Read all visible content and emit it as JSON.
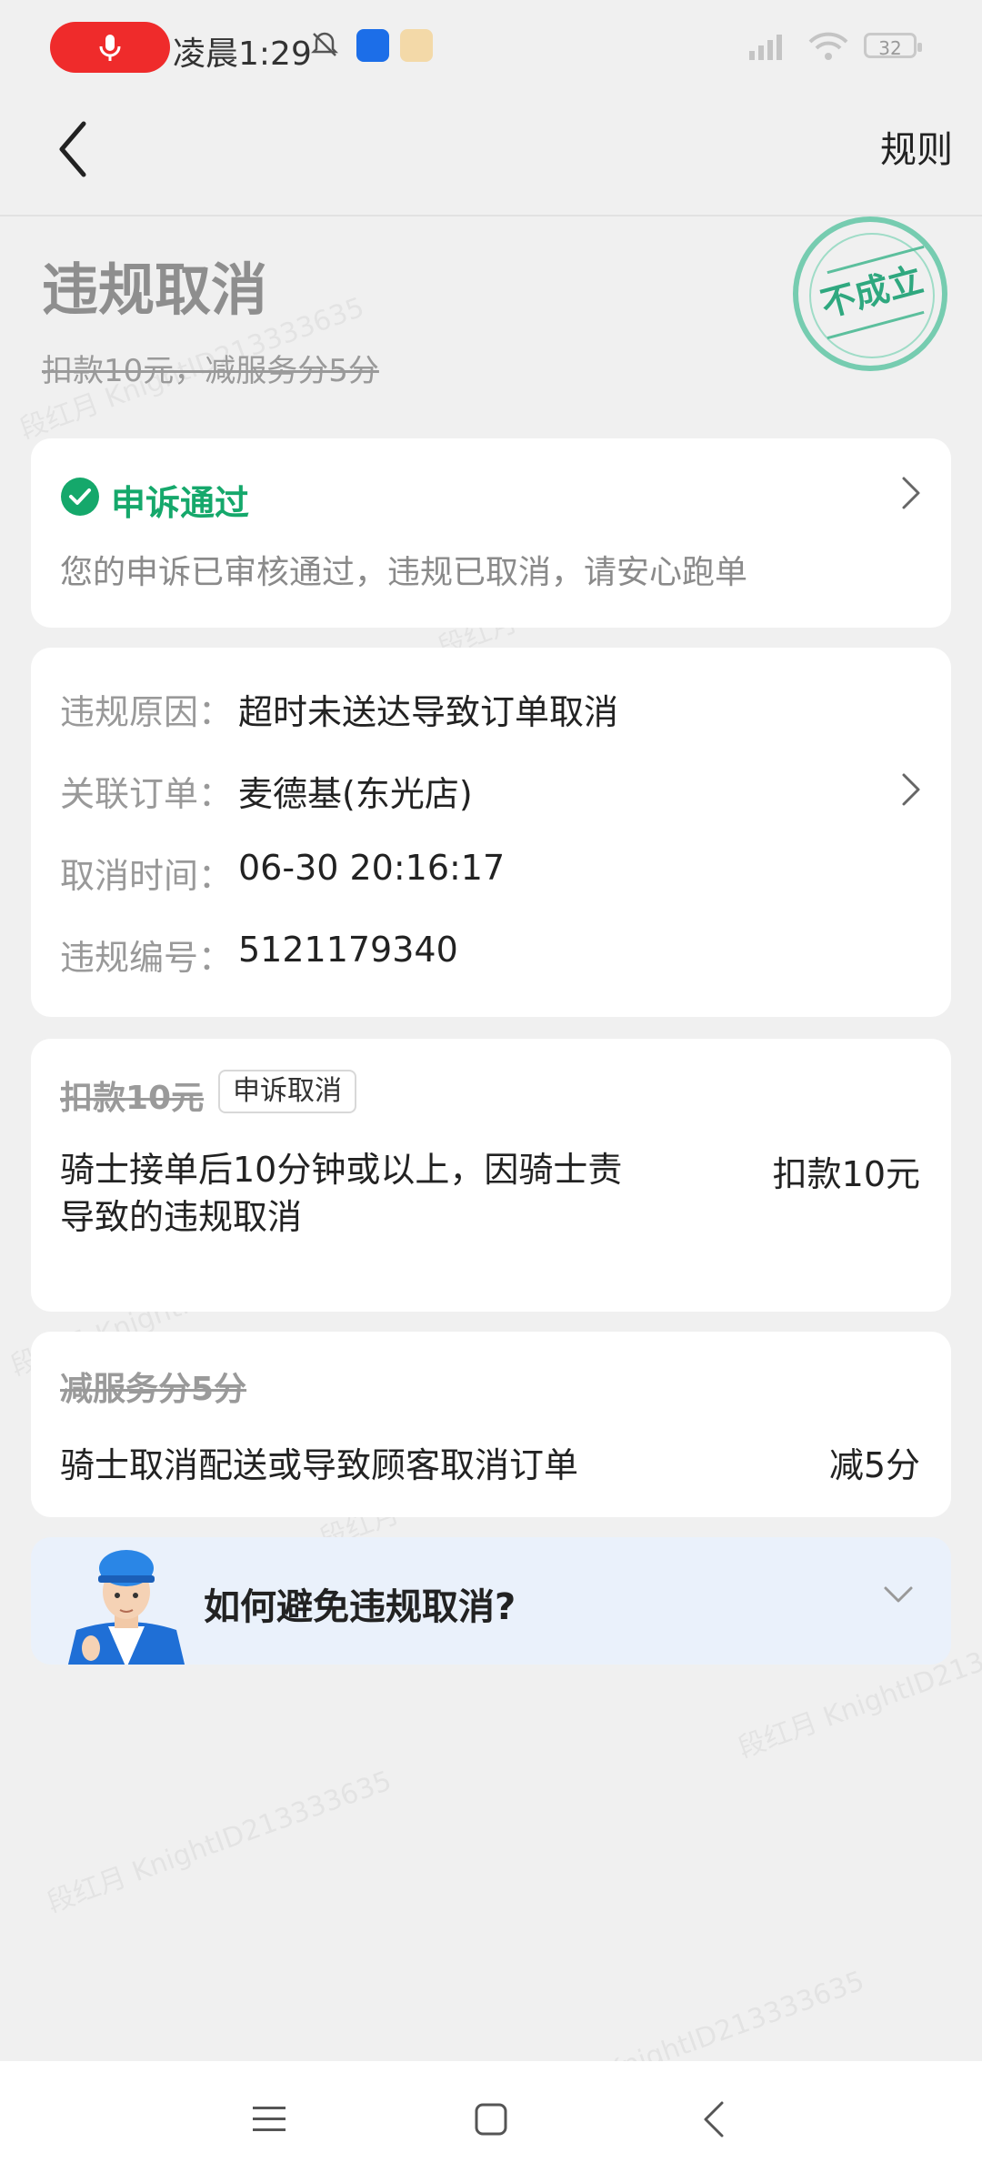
{
  "status_bar": {
    "time": "凌晨1:29",
    "battery": "32"
  },
  "header": {
    "rules_label": "规则"
  },
  "hero": {
    "title": "违规取消",
    "subtitle": "扣款10元，减服务分5分",
    "stamp_text": "不成立"
  },
  "appeal": {
    "status": "申诉通过",
    "description": "您的申诉已审核通过，违规已取消，请安心跑单"
  },
  "details": [
    {
      "label": "违规原因：",
      "value": "超时未送达导致订单取消"
    },
    {
      "label": "关联订单：",
      "value": "麦德基(东光店)"
    },
    {
      "label": "取消时间：",
      "value": "06-30 20:16:17"
    },
    {
      "label": "违规编号：",
      "value": "5121179340"
    }
  ],
  "penalty": {
    "title": "扣款10元",
    "badge": "申诉取消",
    "description": "骑士接单后10分钟或以上，因骑士责导致的违规取消",
    "amount": "扣款10元"
  },
  "score": {
    "title": "减服务分5分",
    "description": "骑士取消配送或导致顾客取消订单",
    "amount": "减5分"
  },
  "tips": {
    "title": "如何避免违规取消?"
  },
  "watermark": "段红月 KnightID213333635",
  "colors": {
    "accent_green": "#15a86b",
    "stamp_green": "#76ccb0",
    "background": "#f0f0f0",
    "tips_bg": "#eaf1fb"
  }
}
